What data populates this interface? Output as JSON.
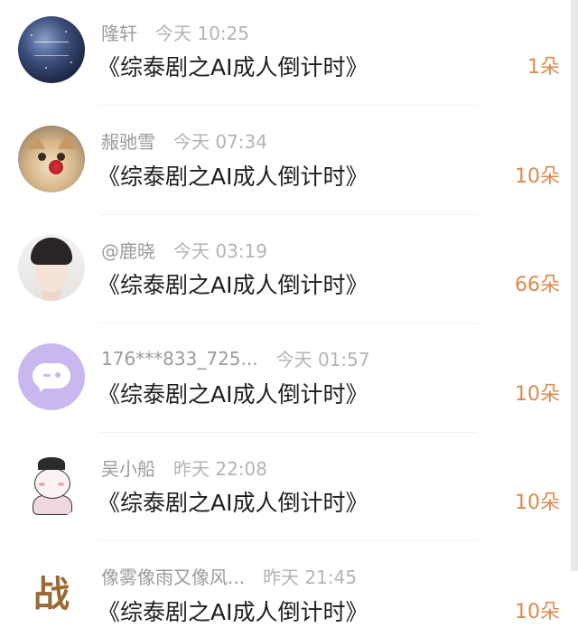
{
  "records": [
    {
      "avatar": "galaxy-avatar",
      "name": "隆轩",
      "time": "今天 10:25",
      "book_title": "《综泰剧之AI成人倒计时》",
      "count": "1朵"
    },
    {
      "avatar": "cat-avatar",
      "name": "赧驰雪",
      "time": "今天 07:34",
      "book_title": "《综泰剧之AI成人倒计时》",
      "count": "10朵"
    },
    {
      "avatar": "person-avatar",
      "name": "@鹿晓",
      "time": "今天 03:19",
      "book_title": "《综泰剧之AI成人倒计时》",
      "count": "66朵"
    },
    {
      "avatar": "default-chat-avatar",
      "name": "176***833_725...",
      "time": "今天 01:57",
      "book_title": "《综泰剧之AI成人倒计时》",
      "count": "10朵"
    },
    {
      "avatar": "cartoon-avatar",
      "name": "吴小船",
      "time": "昨天 22:08",
      "book_title": "《综泰剧之AI成人倒计时》",
      "count": "10朵"
    },
    {
      "avatar": "calligraphy-logo-avatar",
      "avatar_text": "战",
      "name": "像雾像雨又像风...",
      "time": "昨天 21:45",
      "book_title": "《综泰剧之AI成人倒计时》",
      "count": "10朵"
    }
  ],
  "colors": {
    "name": "#9b9b9b",
    "time": "#b4b4b4",
    "title": "#1f1f1f",
    "count": "#dc8a4f",
    "default_avatar": "#c9b8ef"
  }
}
